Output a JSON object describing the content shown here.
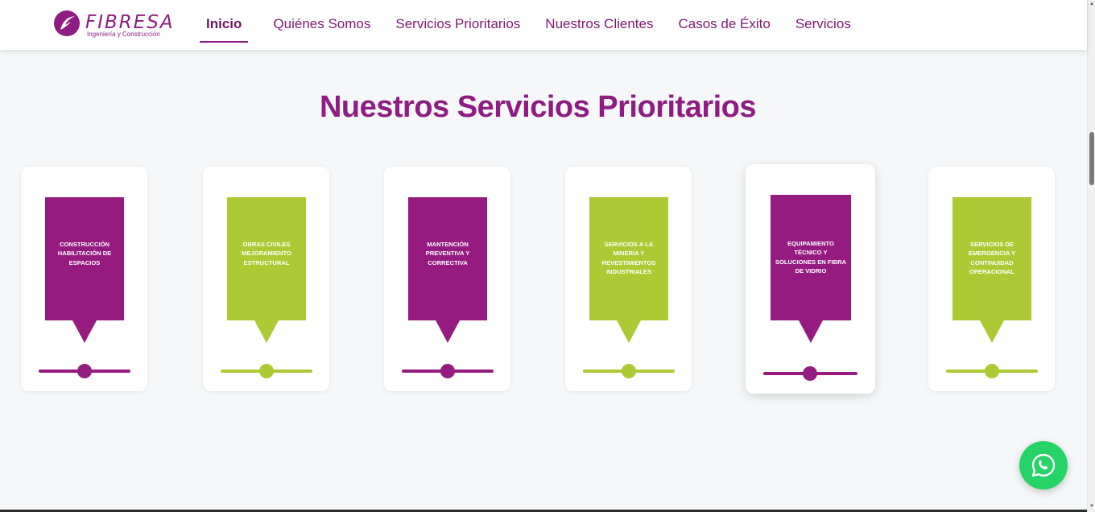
{
  "brand": {
    "name": "FIBRESA",
    "tagline": "Ingeniería y Construcción",
    "color": "#8e1c82"
  },
  "nav": {
    "items": [
      {
        "label": "Inicio",
        "active": true
      },
      {
        "label": "Quiénes Somos",
        "active": false
      },
      {
        "label": "Servicios Prioritarios",
        "active": false
      },
      {
        "label": "Nuestros Clientes",
        "active": false
      },
      {
        "label": "Casos de Éxito",
        "active": false
      },
      {
        "label": "Servicios",
        "active": false
      }
    ]
  },
  "section": {
    "title": "Nuestros Servicios Prioritarios"
  },
  "colors": {
    "purple": "#951b81",
    "green": "#adc933",
    "whatsapp": "#25d366"
  },
  "services": [
    {
      "label": "CONSTRUCCIÓN HABILITACIÓN DE ESPACIOS",
      "color": "purple"
    },
    {
      "label": "OBRAS CIVILES MEJORAMIENTO ESTRUCTURAL",
      "color": "green"
    },
    {
      "label": "MANTENCIÓN PREVENTIVA Y CORRECTIVA",
      "color": "purple"
    },
    {
      "label": "SERVICIOS A LA MINERÍA Y REVESTIMIENTOS INDUSTRIALES",
      "color": "green"
    },
    {
      "label": "EQUIPAMIENTO TÉCNICO Y SOLUCIONES EN FIBRA DE VIDRIO",
      "color": "purple",
      "hovered": true
    },
    {
      "label": "SERVICIOS DE EMERGENCIA Y CONTINUIDAD OPERACIONAL",
      "color": "green"
    }
  ],
  "whatsapp": {
    "icon": "whatsapp-icon"
  }
}
